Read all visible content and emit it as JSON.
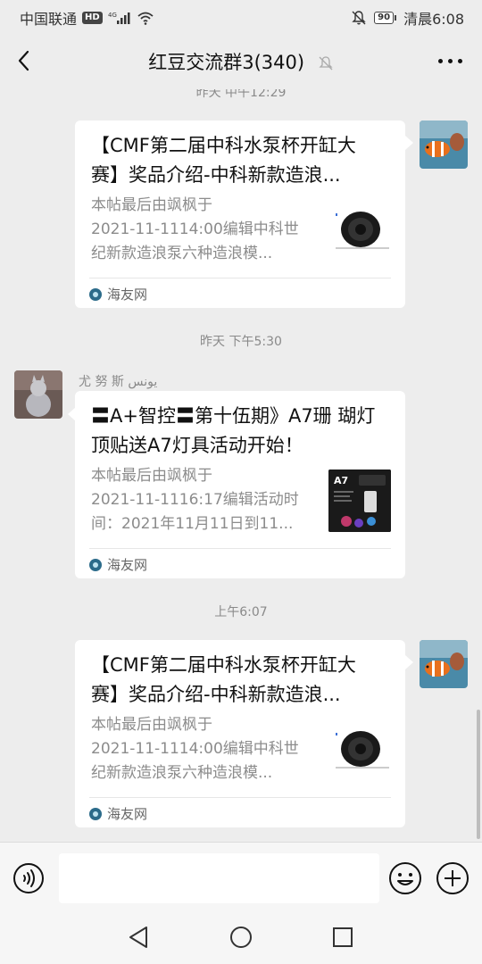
{
  "status_bar": {
    "carrier": "中国联通",
    "network_badge": "HD",
    "network_type": "4G",
    "battery": "90",
    "time": "清晨6:08"
  },
  "header": {
    "title": "红豆交流群3(340)",
    "back_icon": "chevron-left-icon",
    "mute_icon": "bell-off-icon",
    "more_icon": "ellipsis-icon"
  },
  "chat": {
    "partial_timestamp": "昨天 中午12:29",
    "messages": [
      {
        "side": "right",
        "card_title": "【CMF第二届中科水泵杯开缸大赛】奖品介绍-中科新款造浪...",
        "card_title_line1": "【CMF第二届中科水泵杯开缸大",
        "card_title_line2": "赛】奖品介绍-中科新款造浪...",
        "desc_line1": "本帖最后由飒枫于",
        "desc_line2": "2021-11-1114:00编辑中科世",
        "desc_line3": "纪新款造浪泵六种造浪模...",
        "source": "海友网"
      },
      {
        "timestamp": "昨天 下午5:30",
        "side": "left",
        "sender": "尤 努 斯 يونس",
        "card_title_line1": "〓A+智控〓第十伍期》A7珊 瑚灯",
        "card_title_line2": "顶贴送A7灯具活动开始！",
        "desc_line1": "本帖最后由飒枫于",
        "desc_line2": "2021-11-1116:17编辑活动时",
        "desc_line3": "间：2021年11月11日到11...",
        "thumb_label": "A7",
        "source": "海友网"
      },
      {
        "timestamp": "上午6:07",
        "side": "right",
        "card_title_line1": "【CMF第二届中科水泵杯开缸大",
        "card_title_line2": "赛】奖品介绍-中科新款造浪...",
        "desc_line1": "本帖最后由飒枫于",
        "desc_line2": "2021-11-1114:00编辑中科世",
        "desc_line3": "纪新款造浪泵六种造浪模...",
        "source": "海友网"
      }
    ]
  },
  "input_bar": {
    "voice_icon": "voice-icon",
    "input_value": "",
    "emoji_icon": "emoji-icon",
    "plus_icon": "plus-icon"
  },
  "nav_bar": {
    "back_icon": "triangle-back-icon",
    "home_icon": "circle-home-icon",
    "recent_icon": "square-recent-icon"
  },
  "colors": {
    "background": "#ededed",
    "card": "#ffffff",
    "muted_text": "#8a8a8a"
  }
}
